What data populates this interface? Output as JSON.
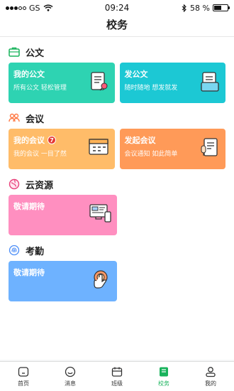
{
  "status": {
    "carrier": "GS",
    "time": "09:24",
    "battery": "58 %",
    "battery_level": 0.58
  },
  "nav": {
    "title": "校务"
  },
  "sections": {
    "doc": {
      "title": "公文",
      "cards": [
        {
          "title": "我的公文",
          "subtitle": "所有公文 轻松管理"
        },
        {
          "title": "发公文",
          "subtitle": "随时随地 想发就发"
        }
      ]
    },
    "meeting": {
      "title": "会议",
      "cards": [
        {
          "title": "我的会议",
          "badge": "7",
          "subtitle": "我的会议 一目了然"
        },
        {
          "title": "发起会议",
          "subtitle": "会议通知 如此简单"
        }
      ]
    },
    "cloud": {
      "title": "云资源",
      "cards": [
        {
          "title": "敬请期待"
        }
      ]
    },
    "attendance": {
      "title": "考勤",
      "cards": [
        {
          "title": "敬请期待"
        }
      ]
    }
  },
  "tabbar": [
    {
      "label": "首页",
      "icon": "home-icon"
    },
    {
      "label": "消息",
      "icon": "message-icon"
    },
    {
      "label": "班级",
      "icon": "class-icon"
    },
    {
      "label": "校务",
      "icon": "school-affairs-icon",
      "active": true
    },
    {
      "label": "我的",
      "icon": "profile-icon"
    }
  ],
  "colors": {
    "accent": "#19b35c"
  }
}
